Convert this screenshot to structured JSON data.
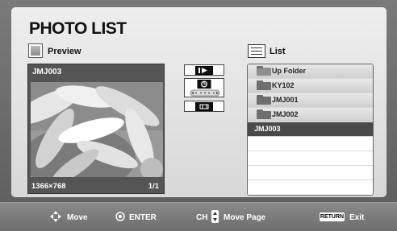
{
  "title": "PHOTO LIST",
  "preview": {
    "header": "Preview",
    "file_name": "JMJ003",
    "resolution": "1366×768",
    "page": "1/1"
  },
  "controls": [
    {
      "icon": "play-icon"
    },
    {
      "icon": "slideshow-speed-icon"
    },
    {
      "icon": "music-icon"
    }
  ],
  "list": {
    "header": "List",
    "items": [
      {
        "label": "Up Folder",
        "icon": "up-folder-icon",
        "state": "dim"
      },
      {
        "label": "KY102",
        "icon": "folder-icon",
        "state": "normal"
      },
      {
        "label": "JMJ001",
        "icon": "folder-icon",
        "state": "normal"
      },
      {
        "label": "JMJ002",
        "icon": "folder-icon",
        "state": "normal"
      },
      {
        "label": "JMJ003",
        "icon": "",
        "state": "selected"
      }
    ]
  },
  "footer": {
    "move": "Move",
    "enter": "ENTER",
    "ch": "CH",
    "move_page": "Move Page",
    "return_key": "RETURN",
    "exit": "Exit"
  },
  "colors": {
    "panel": "#e4e4e4",
    "selected_row": "#4a4a4a",
    "footer": "#7d7d7d"
  }
}
